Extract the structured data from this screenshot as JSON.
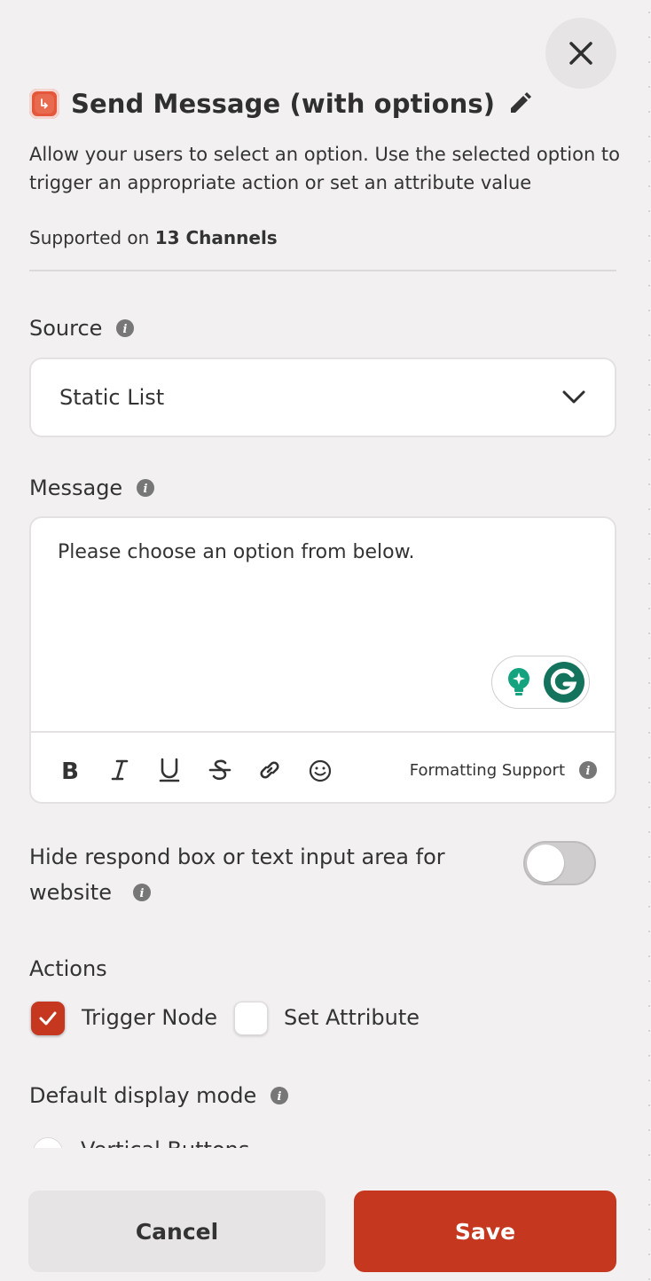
{
  "header": {
    "title": "Send Message (with options)",
    "description": "Allow your users to select an option. Use the selected option to trigger an appropriate action or set an attribute value",
    "supported_prefix": "Supported on ",
    "supported_count": "13 Channels"
  },
  "source": {
    "label": "Source",
    "selected": "Static List"
  },
  "message": {
    "label": "Message",
    "value": "Please choose an option from below.",
    "formatting_support": "Formatting Support"
  },
  "hide_respond": {
    "label_line1": "Hide respond box or text input area for",
    "label_line2": "website",
    "enabled": false
  },
  "actions": {
    "label": "Actions",
    "options": [
      {
        "label": "Trigger Node",
        "checked": true
      },
      {
        "label": "Set Attribute",
        "checked": false
      }
    ]
  },
  "display_mode": {
    "label": "Default display mode",
    "first_option": "Vertical Buttons"
  },
  "footer": {
    "cancel_label": "Cancel",
    "save_label": "Save"
  },
  "colors": {
    "accent": "#c5371f",
    "node_icon": "#e4573b",
    "grammarly": "#15a37f"
  }
}
